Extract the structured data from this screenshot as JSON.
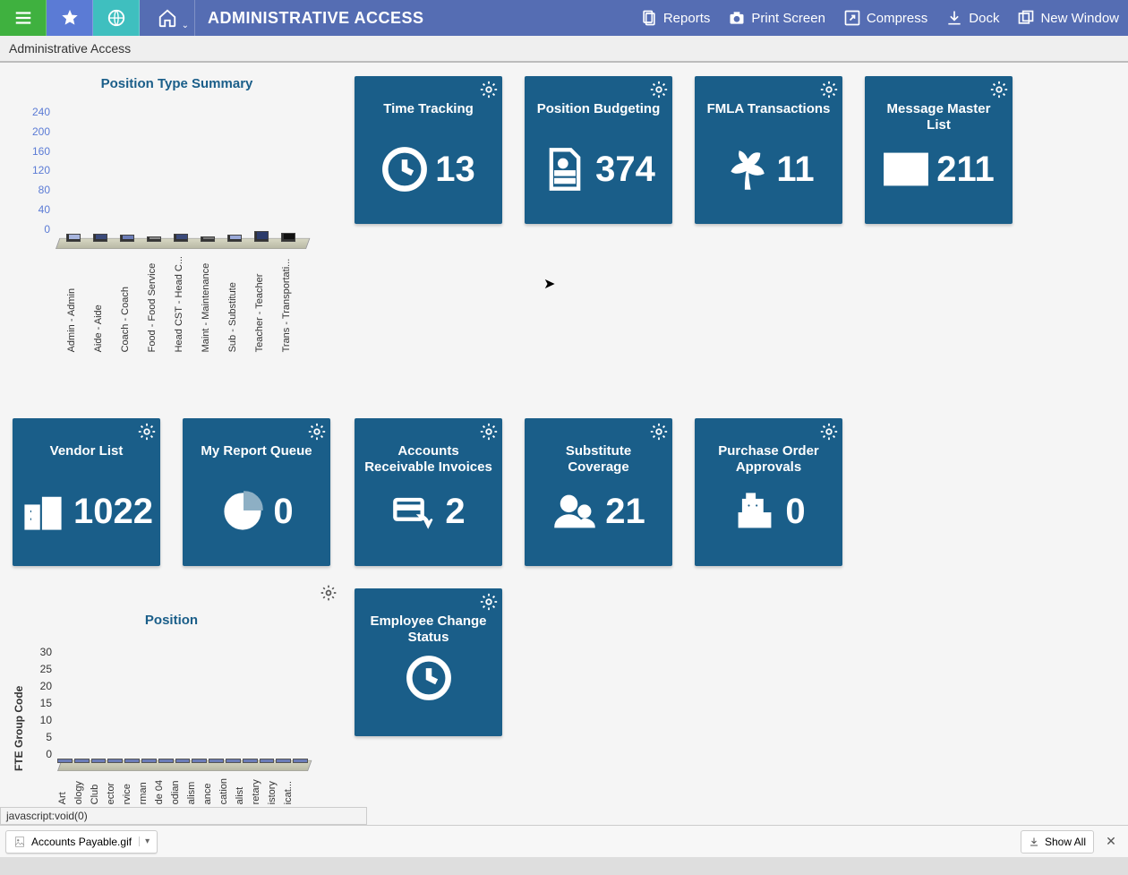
{
  "topbar": {
    "title": "ADMINISTRATIVE ACCESS",
    "actions": {
      "reports": "Reports",
      "print": "Print Screen",
      "compress": "Compress",
      "dock": "Dock",
      "newwin": "New Window"
    }
  },
  "breadcrumb": "Administrative Access",
  "tiles": {
    "time": {
      "title": "Time Tracking",
      "value": "13"
    },
    "posbudget": {
      "title": "Position Budgeting",
      "value": "374"
    },
    "fmla": {
      "title": "FMLA Transactions",
      "value": "11"
    },
    "msg": {
      "title": "Message Master List",
      "value": "211"
    },
    "vendor": {
      "title": "Vendor List",
      "value": "1022"
    },
    "report": {
      "title": "My Report Queue",
      "value": "0"
    },
    "ar": {
      "title": "Accounts Receivable Invoices",
      "value": "2"
    },
    "sub": {
      "title": "Substitute Coverage",
      "value": "21"
    },
    "po": {
      "title": "Purchase Order Approvals",
      "value": "0"
    },
    "emp": {
      "title": "Employee Change Status",
      "value": ""
    }
  },
  "chart1": {
    "title": "Position Type Summary",
    "yticks": [
      "240",
      "200",
      "160",
      "120",
      "80",
      "40",
      "0"
    ]
  },
  "chart2": {
    "title": "Position",
    "ylabel": "FTE Group Code",
    "yticks": [
      "30",
      "25",
      "20",
      "15",
      "10",
      "5",
      "0"
    ]
  },
  "chart_data": [
    {
      "type": "bar",
      "title": "Position Type Summary",
      "ylim": [
        0,
        240
      ],
      "categories": [
        "Admin - Admin",
        "Aide - Aide",
        "Coach - Coach",
        "Food - Food Service",
        "Head CST - Head C...",
        "Maint - Maintenance",
        "Sub - Substitute",
        "Teacher - Teacher",
        "Trans - Transportati..."
      ],
      "values": [
        9,
        9,
        8,
        6,
        9,
        6,
        8,
        12,
        10
      ]
    },
    {
      "type": "bar",
      "title": "Position",
      "ylabel": "FTE Group Code",
      "ylim": [
        0,
        30
      ],
      "categories": [
        "Art",
        "ology",
        "Club",
        "ector",
        "rvice",
        "rman",
        "de 04",
        "odian",
        "alism",
        "ance",
        "cation",
        "alist",
        "retary",
        "istory",
        "icat..."
      ],
      "values": [
        2,
        2,
        2,
        2,
        2,
        2,
        2,
        2,
        2,
        2,
        2,
        2,
        2,
        2,
        2
      ]
    }
  ],
  "status": {
    "text": "javascript:void(0)"
  },
  "download": {
    "filename": "Accounts Payable.gif",
    "showall": "Show All"
  }
}
